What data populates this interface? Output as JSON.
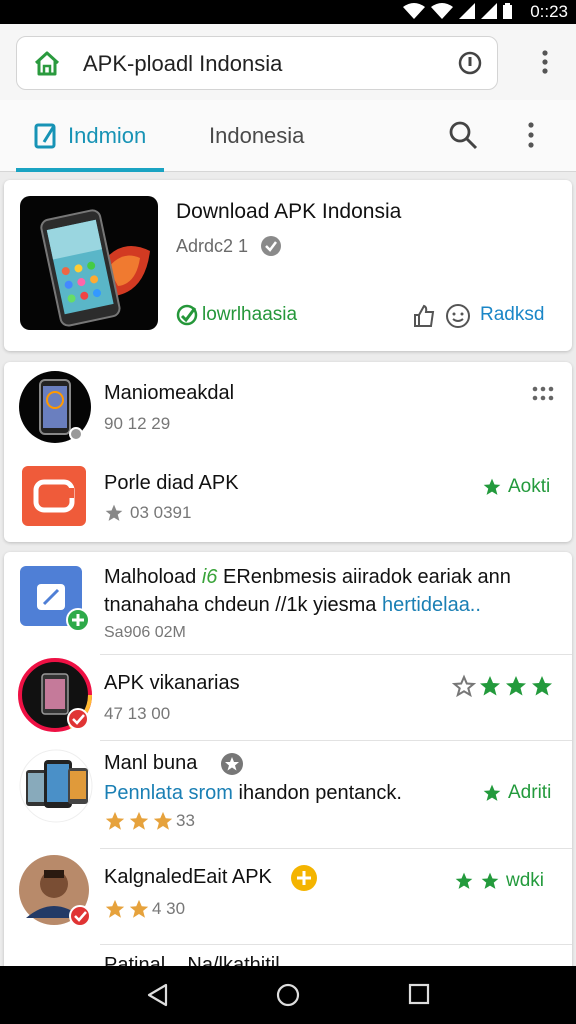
{
  "status": {
    "time": "0::23"
  },
  "browser": {
    "url": "APK-ploadl Indonsia"
  },
  "tabs": [
    {
      "label": "Indmion"
    },
    {
      "label": "Indonesia"
    }
  ],
  "featured": {
    "title": "Download APK Indonsia",
    "subtitle": "Adrdc2 1",
    "download_label": "lowrlhaasia",
    "read_more": "Radksd"
  },
  "apps": [
    {
      "title": "Maniomeakdal",
      "sub": "90 12 29"
    },
    {
      "title": "Porle diad APK",
      "sub": "03 0391",
      "action": "Aokti"
    },
    {
      "title": "Malhoload",
      "highlight": "i6",
      "rest": " ERenbmesis aiiradok eariak ann",
      "line2_a": "tnanahaha chdeun //1k yiesma ",
      "line2_b": "hertidelaa..",
      "sub": "Sa906 02M"
    },
    {
      "title": "APK vikanarias",
      "sub": "47 13 00"
    },
    {
      "title": "Manl buna",
      "link": "Pennlata srom ",
      "link_rest": "ihandon pentanck.",
      "rating": "33",
      "action": "Adriti"
    },
    {
      "title": "KalgnaledEait APK",
      "rating": "4 30",
      "action": "wdki"
    },
    {
      "title": "Patinal... Na/lkathitil..."
    }
  ],
  "colors": {
    "accent": "#1aa3c2",
    "green": "#239a3c",
    "star": "#e6a23c"
  }
}
